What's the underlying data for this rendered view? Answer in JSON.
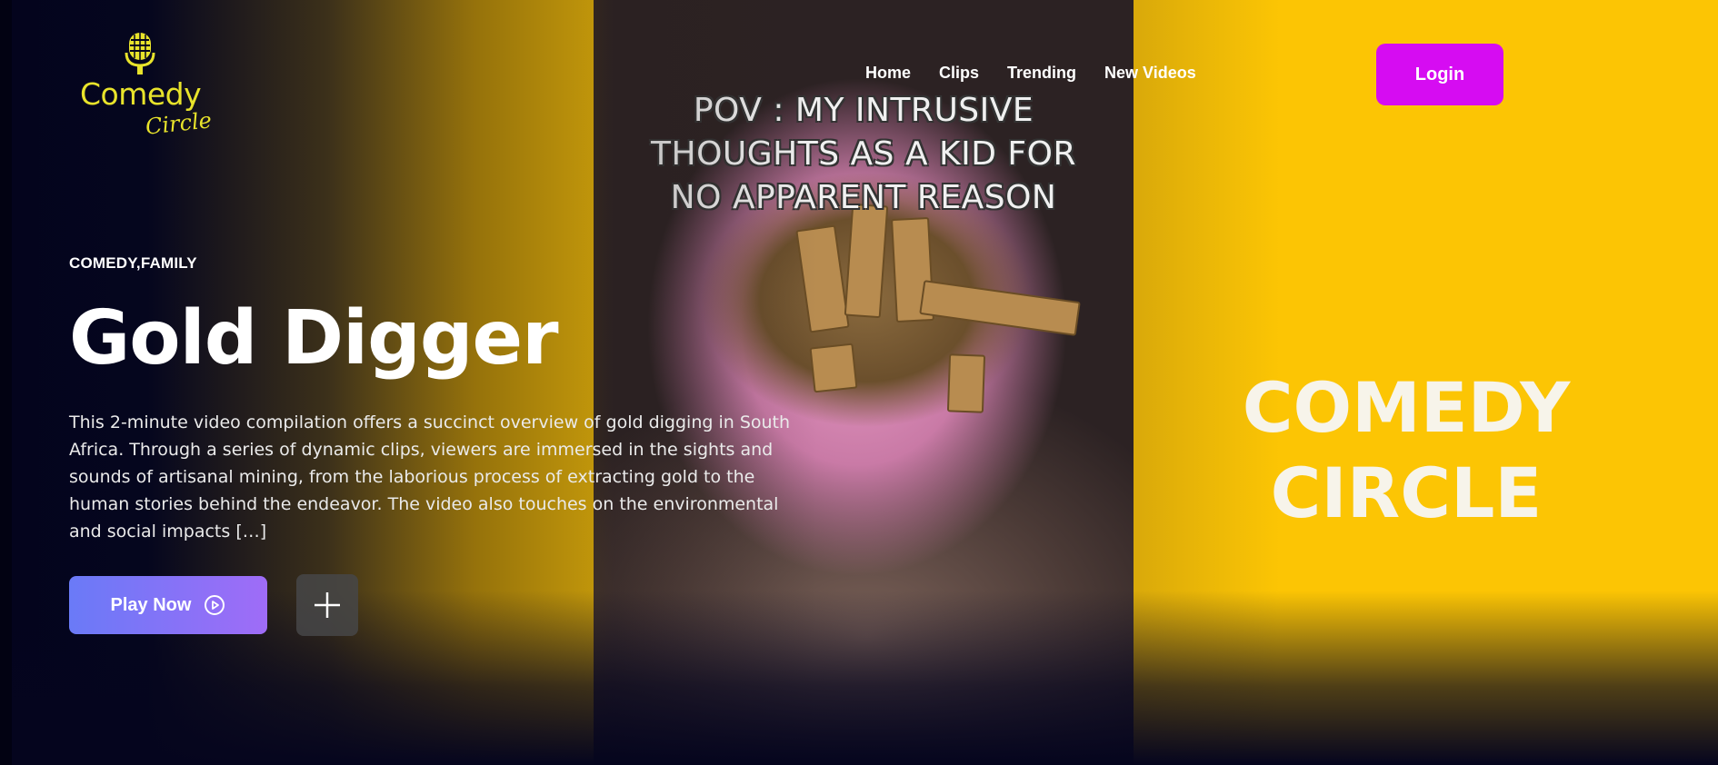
{
  "brand": {
    "logo_word": "Comedy",
    "logo_script": "Circle"
  },
  "nav": {
    "items": [
      "Home",
      "Clips",
      "Trending",
      "New Videos"
    ],
    "login_label": "Login"
  },
  "hero": {
    "genres": "COMEDY,FAMILY",
    "title": "Gold Digger",
    "description": "This 2-minute video compilation offers a succinct overview of gold digging in South Africa. Through a series of dynamic clips, viewers are immersed in the sights and sounds of artisanal mining, from the laborious process of extracting gold to the human stories behind the endeavor. The video also touches on the environmental and social impacts […]",
    "play_label": "Play Now",
    "play_icon": "play-circle-icon",
    "add_icon": "plus-icon"
  },
  "backdrop": {
    "video_caption": [
      "POV : MY INTRUSIVE",
      "THOUGHTS AS A KID FOR",
      "NO APPARENT REASON"
    ],
    "brand_text": [
      "COMEDY",
      "CIRCLE"
    ]
  },
  "colors": {
    "accent_login": "#d60cf2",
    "play_start": "#6a7af7",
    "play_end": "#9f6cf7",
    "yellow": "#fcc504",
    "logo": "#e8e32b",
    "background": "#05051e"
  }
}
